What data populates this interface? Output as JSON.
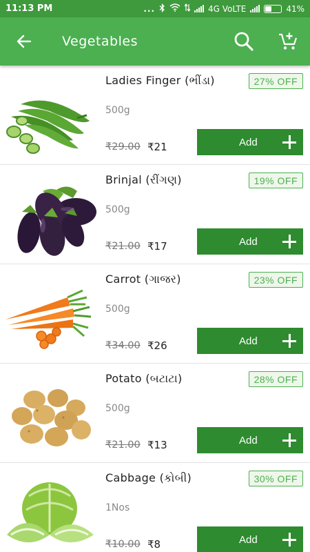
{
  "status_bar": {
    "time": "11:13 PM",
    "dots": "...",
    "network": "4G VoLTE",
    "battery": "41%"
  },
  "app_bar": {
    "title": "Vegetables",
    "icons": [
      "back-arrow-icon",
      "search-icon",
      "add-to-cart-icon"
    ]
  },
  "colors": {
    "primary": "#4caf50",
    "status_bar": "#3e9a3c",
    "button": "#2e8b2f"
  },
  "products": [
    {
      "name": "Ladies Finger (ભીંડા)",
      "discount": "27% OFF",
      "quantity": "500g",
      "mrp": "₹29.00",
      "price": "₹21",
      "add_label": "Add",
      "image": "okra-image"
    },
    {
      "name": "Brinjal (રીંગણ)",
      "discount": "19% OFF",
      "quantity": "500g",
      "mrp": "₹21.00",
      "price": "₹17",
      "add_label": "Add",
      "image": "brinjal-image"
    },
    {
      "name": "Carrot (ગાજર)",
      "discount": "23% OFF",
      "quantity": "500g",
      "mrp": "₹34.00",
      "price": "₹26",
      "add_label": "Add",
      "image": "carrot-image"
    },
    {
      "name": "Potato (બટાટા)",
      "discount": "28% OFF",
      "quantity": "500g",
      "mrp": "₹21.00",
      "price": "₹13",
      "add_label": "Add",
      "image": "potato-image"
    },
    {
      "name": "Cabbage (કોબી)",
      "discount": "30% OFF",
      "quantity": "1Nos",
      "mrp": "₹10.00",
      "price": "₹8",
      "add_label": "Add",
      "image": "cabbage-image"
    }
  ]
}
